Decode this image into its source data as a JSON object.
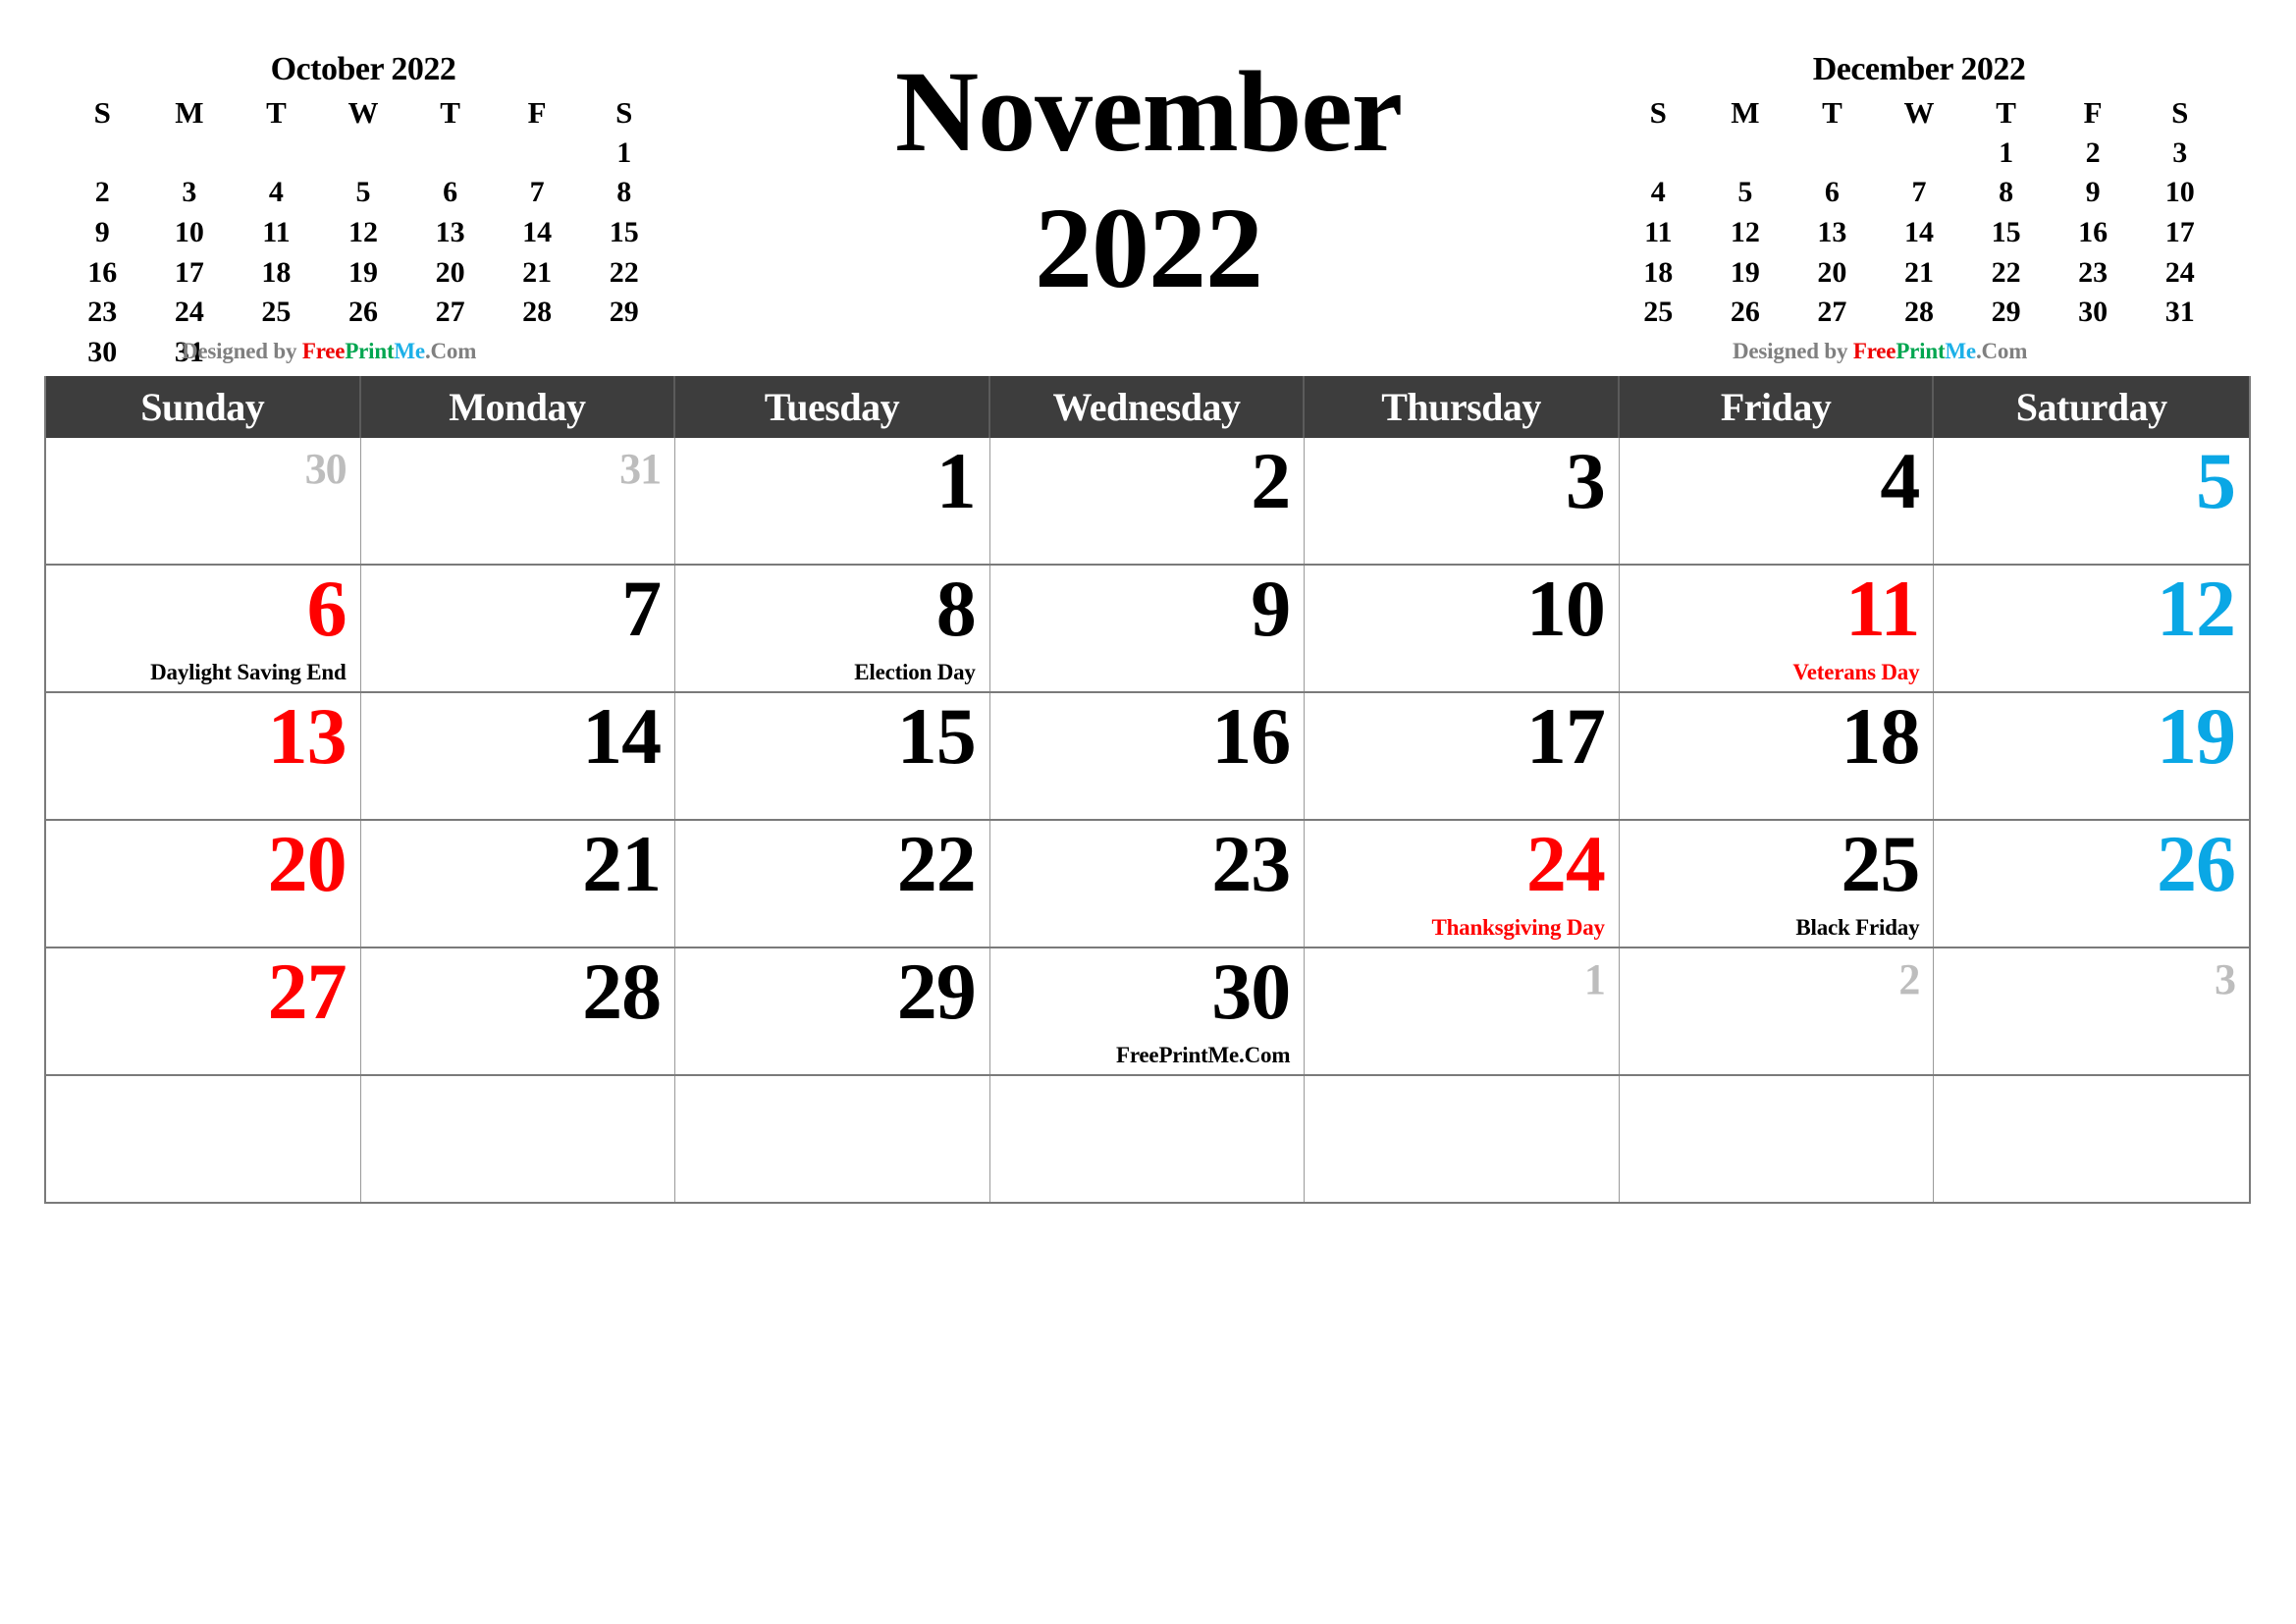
{
  "header": {
    "title_month": "November",
    "title_year": "2022"
  },
  "credits": {
    "prefix": "Designed by ",
    "brand_free": "Free",
    "brand_print": "Print",
    "brand_me": "Me",
    "brand_com": ".Com",
    "colors": {
      "gray": "#808080",
      "red": "#ee0000",
      "green": "#00a650",
      "blue": "#1cb0e8"
    }
  },
  "mini_prev": {
    "title": "October 2022",
    "dow": [
      "S",
      "M",
      "T",
      "W",
      "T",
      "F",
      "S"
    ],
    "weeks": [
      [
        "",
        "",
        "",
        "",
        "",
        "",
        "1"
      ],
      [
        "2",
        "3",
        "4",
        "5",
        "6",
        "7",
        "8"
      ],
      [
        "9",
        "10",
        "11",
        "12",
        "13",
        "14",
        "15"
      ],
      [
        "16",
        "17",
        "18",
        "19",
        "20",
        "21",
        "22"
      ],
      [
        "23",
        "24",
        "25",
        "26",
        "27",
        "28",
        "29"
      ],
      [
        "30",
        "31",
        "",
        "",
        "",
        "",
        ""
      ]
    ]
  },
  "mini_next": {
    "title": "December 2022",
    "dow": [
      "S",
      "M",
      "T",
      "W",
      "T",
      "F",
      "S"
    ],
    "weeks": [
      [
        "",
        "",
        "",
        "",
        "1",
        "2",
        "3"
      ],
      [
        "4",
        "5",
        "6",
        "7",
        "8",
        "9",
        "10"
      ],
      [
        "11",
        "12",
        "13",
        "14",
        "15",
        "16",
        "17"
      ],
      [
        "18",
        "19",
        "20",
        "21",
        "22",
        "23",
        "24"
      ],
      [
        "25",
        "26",
        "27",
        "28",
        "29",
        "30",
        "31"
      ]
    ]
  },
  "grid": {
    "weekday_headers": [
      "Sunday",
      "Monday",
      "Tuesday",
      "Wednesday",
      "Thursday",
      "Friday",
      "Saturday"
    ],
    "colors": {
      "header_bg": "#3d3d3d",
      "header_text": "#ffffff",
      "sunday": "#ff0000",
      "saturday": "#0aa7e5",
      "holiday": "#ff0000",
      "weekday": "#000000",
      "outside_month": "#bdbdbd",
      "grid_line": "#9a9a9a"
    },
    "weeks": [
      [
        {
          "num": "30",
          "kind": "out",
          "label": ""
        },
        {
          "num": "31",
          "kind": "out",
          "label": ""
        },
        {
          "num": "1",
          "kind": "day",
          "label": ""
        },
        {
          "num": "2",
          "kind": "day",
          "label": ""
        },
        {
          "num": "3",
          "kind": "day",
          "label": ""
        },
        {
          "num": "4",
          "kind": "day",
          "label": ""
        },
        {
          "num": "5",
          "kind": "sat",
          "label": ""
        }
      ],
      [
        {
          "num": "6",
          "kind": "sun",
          "label": "Daylight Saving End",
          "label_color": "black"
        },
        {
          "num": "7",
          "kind": "day",
          "label": ""
        },
        {
          "num": "8",
          "kind": "day",
          "label": "Election Day",
          "label_color": "black"
        },
        {
          "num": "9",
          "kind": "day",
          "label": ""
        },
        {
          "num": "10",
          "kind": "day",
          "label": ""
        },
        {
          "num": "11",
          "kind": "hol",
          "label": "Veterans Day",
          "label_color": "red"
        },
        {
          "num": "12",
          "kind": "sat",
          "label": ""
        }
      ],
      [
        {
          "num": "13",
          "kind": "sun",
          "label": ""
        },
        {
          "num": "14",
          "kind": "day",
          "label": ""
        },
        {
          "num": "15",
          "kind": "day",
          "label": ""
        },
        {
          "num": "16",
          "kind": "day",
          "label": ""
        },
        {
          "num": "17",
          "kind": "day",
          "label": ""
        },
        {
          "num": "18",
          "kind": "day",
          "label": ""
        },
        {
          "num": "19",
          "kind": "sat",
          "label": ""
        }
      ],
      [
        {
          "num": "20",
          "kind": "sun",
          "label": ""
        },
        {
          "num": "21",
          "kind": "day",
          "label": ""
        },
        {
          "num": "22",
          "kind": "day",
          "label": ""
        },
        {
          "num": "23",
          "kind": "day",
          "label": ""
        },
        {
          "num": "24",
          "kind": "hol",
          "label": "Thanksgiving Day",
          "label_color": "red"
        },
        {
          "num": "25",
          "kind": "day",
          "label": "Black Friday",
          "label_color": "black"
        },
        {
          "num": "26",
          "kind": "sat",
          "label": ""
        }
      ],
      [
        {
          "num": "27",
          "kind": "sun",
          "label": ""
        },
        {
          "num": "28",
          "kind": "day",
          "label": ""
        },
        {
          "num": "29",
          "kind": "day",
          "label": ""
        },
        {
          "num": "30",
          "kind": "day",
          "label": "FreePrintMe.Com",
          "label_color": "black"
        },
        {
          "num": "1",
          "kind": "out",
          "label": ""
        },
        {
          "num": "2",
          "kind": "out",
          "label": ""
        },
        {
          "num": "3",
          "kind": "out",
          "label": ""
        }
      ],
      [
        {
          "num": "",
          "kind": "blank",
          "label": ""
        },
        {
          "num": "",
          "kind": "blank",
          "label": ""
        },
        {
          "num": "",
          "kind": "blank",
          "label": ""
        },
        {
          "num": "",
          "kind": "blank",
          "label": ""
        },
        {
          "num": "",
          "kind": "blank",
          "label": ""
        },
        {
          "num": "",
          "kind": "blank",
          "label": ""
        },
        {
          "num": "",
          "kind": "blank",
          "label": ""
        }
      ]
    ]
  }
}
